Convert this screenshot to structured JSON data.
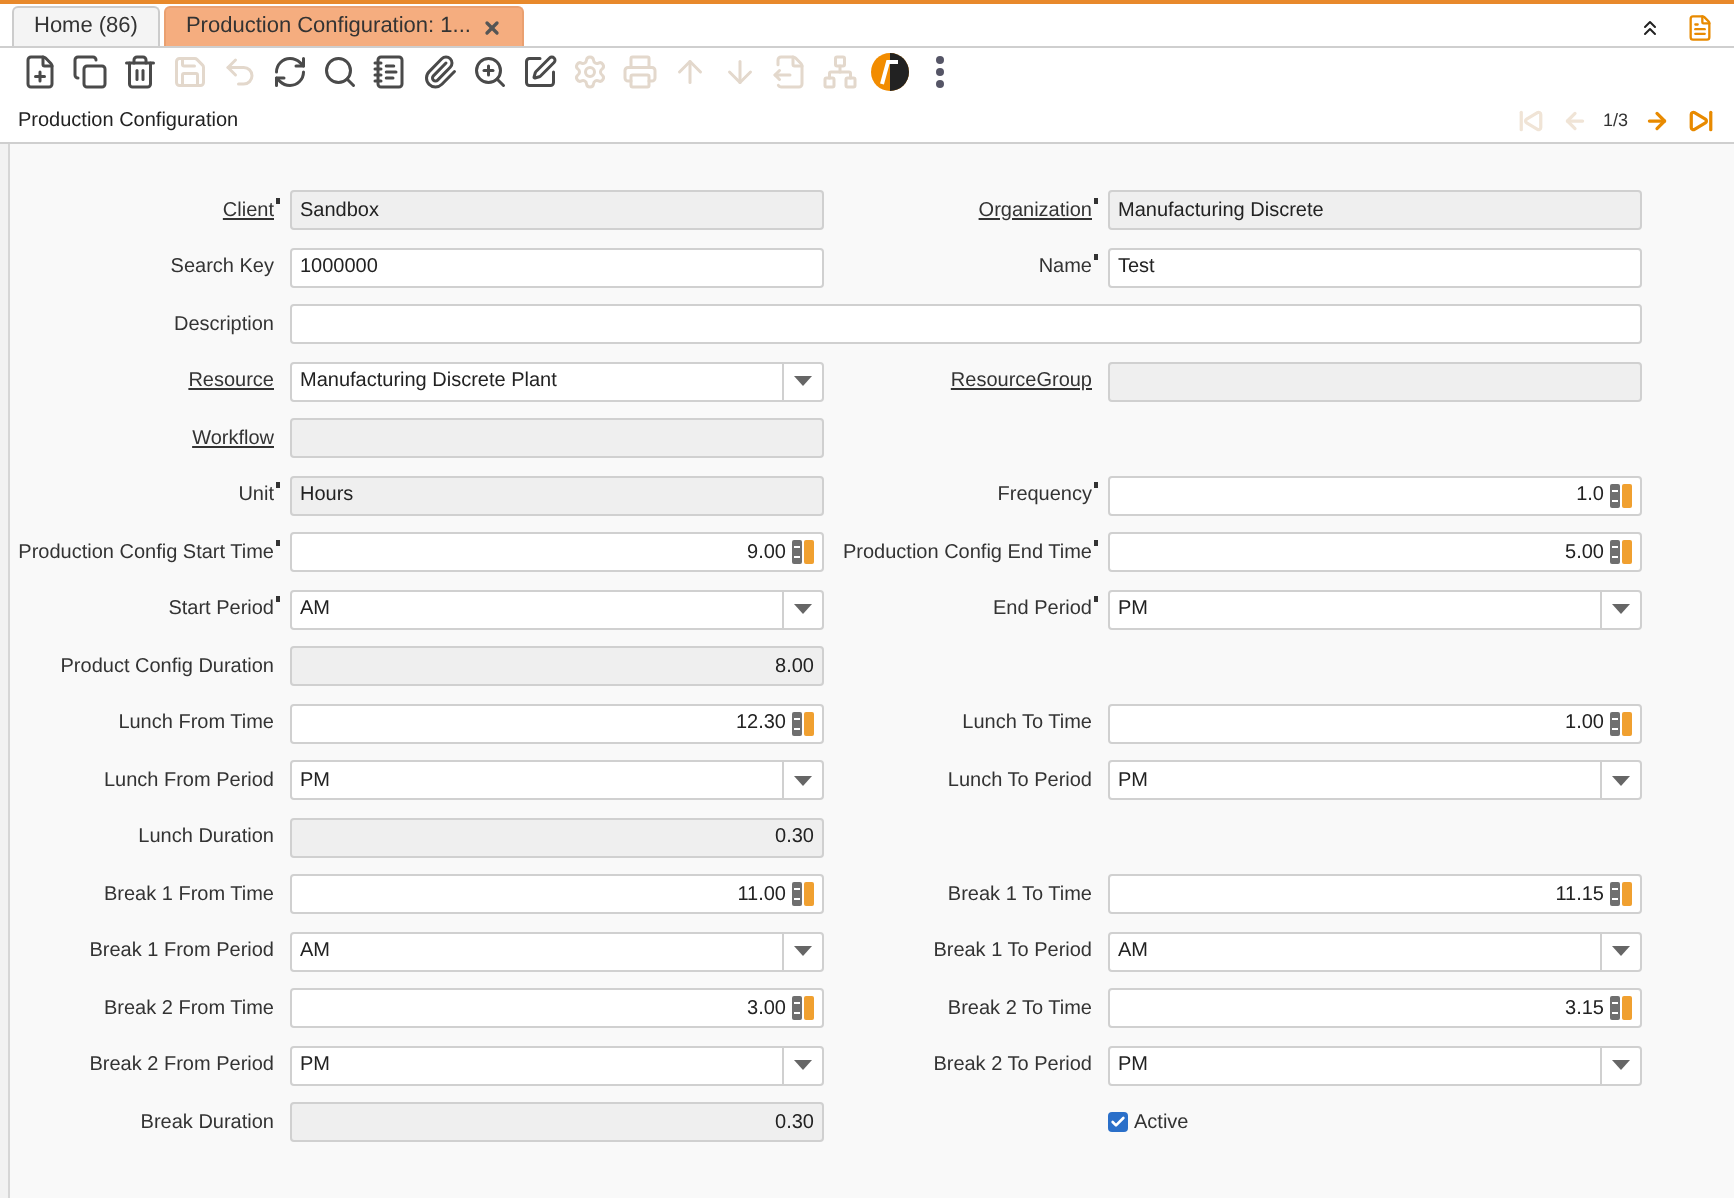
{
  "tabs": [
    {
      "label": "Home (86)",
      "selected": false,
      "closable": false
    },
    {
      "label": "Production Configuration: 1...",
      "selected": true,
      "closable": true
    }
  ],
  "toolbar": [
    {
      "kind": "new",
      "disabled": false
    },
    {
      "kind": "copy",
      "disabled": false
    },
    {
      "kind": "delete",
      "disabled": false
    },
    {
      "kind": "save",
      "disabled": true
    },
    {
      "kind": "undo",
      "disabled": true
    },
    {
      "kind": "refresh",
      "disabled": false
    },
    {
      "kind": "search",
      "disabled": false
    },
    {
      "kind": "notes",
      "disabled": false
    },
    {
      "kind": "attach",
      "disabled": false
    },
    {
      "kind": "zoom",
      "disabled": false
    },
    {
      "kind": "edit",
      "disabled": false
    },
    {
      "kind": "gear",
      "disabled": true
    },
    {
      "kind": "print",
      "disabled": true
    },
    {
      "kind": "up",
      "disabled": true
    },
    {
      "kind": "down",
      "disabled": true
    },
    {
      "kind": "export",
      "disabled": true
    },
    {
      "kind": "tree",
      "disabled": true
    },
    {
      "kind": "logo",
      "disabled": false
    },
    {
      "kind": "more",
      "disabled": false
    }
  ],
  "title": "Production Configuration",
  "pager": {
    "text": "1/3",
    "first_disabled": true,
    "prev_disabled": true,
    "next_disabled": false,
    "last_disabled": false
  },
  "rows": [
    {
      "fields": [
        {
          "label": "Client",
          "link": true,
          "mandatory": true,
          "kind": "readonly",
          "value": "Sandbox"
        },
        {
          "label": "Organization",
          "link": true,
          "mandatory": true,
          "kind": "readonly",
          "value": "Manufacturing Discrete"
        }
      ]
    },
    {
      "fields": [
        {
          "label": "Search Key",
          "link": false,
          "mandatory": false,
          "kind": "text",
          "value": "1000000"
        },
        {
          "label": "Name",
          "link": false,
          "mandatory": true,
          "kind": "text",
          "value": "Test"
        }
      ]
    },
    {
      "fields": [
        {
          "label": "Description",
          "link": false,
          "mandatory": false,
          "kind": "wide"
        }
      ]
    },
    {
      "fields": [
        {
          "label": "Resource",
          "link": true,
          "mandatory": false,
          "kind": "select",
          "value": "Manufacturing Discrete Plant"
        },
        {
          "label": "ResourceGroup",
          "link": true,
          "mandatory": false,
          "kind": "readonly"
        }
      ]
    },
    {
      "fields": [
        {
          "label": "Workflow",
          "link": true,
          "mandatory": false,
          "kind": "readonly"
        }
      ]
    },
    {
      "fields": [
        {
          "label": "Unit",
          "link": false,
          "mandatory": true,
          "kind": "readonly",
          "value": "Hours"
        },
        {
          "label": "Frequency",
          "link": false,
          "mandatory": true,
          "kind": "number",
          "value": "1.0"
        }
      ]
    },
    {
      "fields": [
        {
          "label": "Production Config Start Time",
          "link": false,
          "mandatory": true,
          "kind": "number",
          "value": "9.00"
        },
        {
          "label": "Production Config End Time",
          "link": false,
          "mandatory": true,
          "kind": "number",
          "value": "5.00"
        }
      ]
    },
    {
      "fields": [
        {
          "label": "Start Period",
          "link": false,
          "mandatory": true,
          "kind": "select",
          "value": "AM"
        },
        {
          "label": "End Period",
          "link": false,
          "mandatory": true,
          "kind": "select",
          "value": "PM"
        }
      ]
    },
    {
      "fields": [
        {
          "label": "Product Config Duration",
          "link": false,
          "mandatory": false,
          "kind": "number_readonly",
          "value": "8.00"
        }
      ]
    },
    {
      "fields": [
        {
          "label": "Lunch From Time",
          "link": false,
          "mandatory": false,
          "kind": "number",
          "value": "12.30"
        },
        {
          "label": "Lunch To Time",
          "link": false,
          "mandatory": false,
          "kind": "number",
          "value": "1.00"
        }
      ]
    },
    {
      "fields": [
        {
          "label": "Lunch From Period",
          "link": false,
          "mandatory": false,
          "kind": "select",
          "value": "PM"
        },
        {
          "label": "Lunch To Period",
          "link": false,
          "mandatory": false,
          "kind": "select",
          "value": "PM"
        }
      ]
    },
    {
      "fields": [
        {
          "label": "Lunch Duration",
          "link": false,
          "mandatory": false,
          "kind": "number_readonly",
          "value": "0.30"
        }
      ]
    },
    {
      "fields": [
        {
          "label": "Break 1 From Time",
          "link": false,
          "mandatory": false,
          "kind": "number",
          "value": "11.00"
        },
        {
          "label": "Break 1 To Time",
          "link": false,
          "mandatory": false,
          "kind": "number",
          "value": "11.15"
        }
      ]
    },
    {
      "fields": [
        {
          "label": "Break 1 From Period",
          "link": false,
          "mandatory": false,
          "kind": "select",
          "value": "AM"
        },
        {
          "label": "Break 1 To Period",
          "link": false,
          "mandatory": false,
          "kind": "select",
          "value": "AM"
        }
      ]
    },
    {
      "fields": [
        {
          "label": "Break 2 From Time",
          "link": false,
          "mandatory": false,
          "kind": "number",
          "value": "3.00"
        },
        {
          "label": "Break 2 To Time",
          "link": false,
          "mandatory": false,
          "kind": "number",
          "value": "3.15"
        }
      ]
    },
    {
      "fields": [
        {
          "label": "Break 2 From Period",
          "link": false,
          "mandatory": false,
          "kind": "select",
          "value": "PM"
        },
        {
          "label": "Break 2 To Period",
          "link": false,
          "mandatory": false,
          "kind": "select",
          "value": "PM"
        }
      ]
    },
    {
      "fields": [
        {
          "label": "Break Duration",
          "link": false,
          "mandatory": false,
          "kind": "number_readonly",
          "value": "0.30"
        },
        {
          "label": "Active",
          "kind": "checkbox",
          "checked": true
        }
      ]
    }
  ]
}
